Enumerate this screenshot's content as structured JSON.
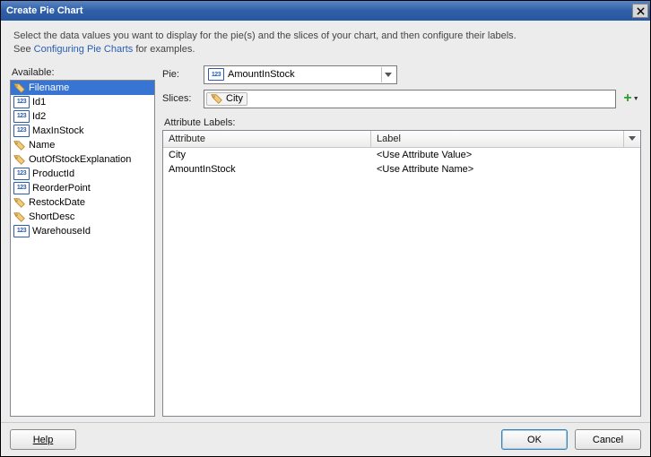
{
  "title": "Create Pie Chart",
  "instruction_line1": "Select the data values you want to display for the pie(s) and the slices of your chart, and then configure their labels.",
  "instruction_prefix": "See ",
  "instruction_link": "Configuring Pie Charts",
  "instruction_suffix": " for examples.",
  "available_label": "Available:",
  "available_items": [
    {
      "icon": "tag",
      "label": "Filename",
      "selected": true
    },
    {
      "icon": "123",
      "label": "Id1"
    },
    {
      "icon": "123",
      "label": "Id2"
    },
    {
      "icon": "123",
      "label": "MaxInStock"
    },
    {
      "icon": "tag",
      "label": "Name"
    },
    {
      "icon": "tag",
      "label": "OutOfStockExplanation"
    },
    {
      "icon": "123",
      "label": "ProductId"
    },
    {
      "icon": "123",
      "label": "ReorderPoint"
    },
    {
      "icon": "tag",
      "label": "RestockDate"
    },
    {
      "icon": "tag",
      "label": "ShortDesc"
    },
    {
      "icon": "123",
      "label": "WarehouseId"
    }
  ],
  "pie_label": "Pie:",
  "pie_value": "AmountInStock",
  "slices_label": "Slices:",
  "slices_chip": "City",
  "attr_labels_heading": "Attribute Labels:",
  "attr_col": "Attribute",
  "label_col": "Label",
  "attr_rows": [
    {
      "attr": "City",
      "label": "<Use Attribute Value>"
    },
    {
      "attr": "AmountInStock",
      "label": "<Use Attribute Name>"
    }
  ],
  "btn_help": "Help",
  "btn_ok": "OK",
  "btn_cancel": "Cancel",
  "icon_123_text": "123"
}
